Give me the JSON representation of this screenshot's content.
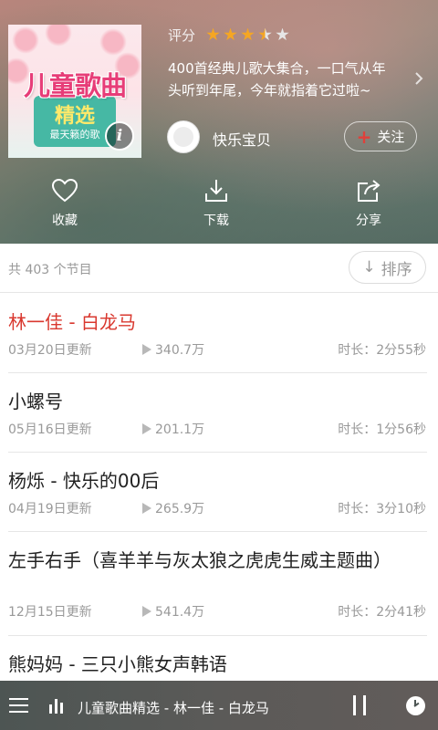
{
  "album": {
    "cover": {
      "title": "儿童歌曲",
      "subtitle": "精选",
      "caption": "最天籁的歌",
      "info_glyph": "i"
    },
    "rating_label": "评分",
    "rating_value": 3.5,
    "rating_max": 5,
    "star_color": "#f5a623",
    "star_empty_color": "#e6e6e6",
    "description_line1": "400首经典儿歌大集合，一口气从年",
    "description_line2": "头听到年尾，今年就指着它过啦~",
    "author_name": "快乐宝贝",
    "follow_label": "关注",
    "follow_plus": "+"
  },
  "actions": [
    {
      "label": "收藏",
      "icon": "heart-icon"
    },
    {
      "label": "下载",
      "icon": "download-icon"
    },
    {
      "label": "分享",
      "icon": "share-icon"
    }
  ],
  "list": {
    "count_text": "共 403 个节目",
    "sort_label": "排序",
    "sort_arrow": "↓",
    "accent_color": "#d9382f",
    "tracks": [
      {
        "title": "林一佳 - 白龙马",
        "date": "03月20日更新",
        "plays": "340.7万",
        "duration": "时长：2分55秒",
        "playing": true
      },
      {
        "title": "小螺号",
        "date": "05月16日更新",
        "plays": "201.1万",
        "duration": "时长：1分56秒",
        "playing": false
      },
      {
        "title": "杨烁 - 快乐的00后",
        "date": "04月19日更新",
        "plays": "265.9万",
        "duration": "时长：3分10秒",
        "playing": false
      },
      {
        "title": "左手右手（喜羊羊与灰太狼之虎虎生威主题曲）",
        "date": "12月15日更新",
        "plays": "541.4万",
        "duration": "时长：2分41秒",
        "playing": false
      },
      {
        "title": "熊妈妈 - 三只小熊女声韩语",
        "date": "",
        "plays": "",
        "duration": "",
        "playing": false
      }
    ]
  },
  "player": {
    "now_playing": "儿童歌曲精选 - 林一佳 - 白龙马"
  }
}
